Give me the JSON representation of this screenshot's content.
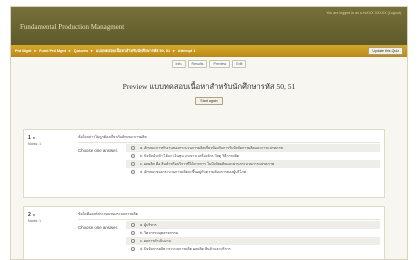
{
  "header": {
    "login_info": "You are logged in as นายXXX XXXXX (Logout)",
    "site_title": "Fundamental Production Managment"
  },
  "navbar": {
    "breadcrumbs": [
      "Prd Mgnt",
      "Fund Prd Mgnt",
      "Quizzes",
      "แบบทดสอบเนื้อหาสำหรับนักศึกษารหัส 50, 51",
      "Attempt 1"
    ],
    "separator": "►",
    "update_button": "Update this Quiz"
  },
  "tabs": [
    "Info",
    "Results",
    "Preview",
    "Edit"
  ],
  "page": {
    "title": "Preview แบบทดสอบเนื้อหาสำหรับนักศึกษารหัส 50, 51",
    "start_again": "Start again"
  },
  "questions": [
    {
      "number": "1",
      "suffix": "ข",
      "marks": "Marks: 1",
      "text": "ข้อใดกล่าวไม่ถูกต้องเกี่ยวกับลักษณะการผลิต",
      "choose_label": "Choose one answer.",
      "options": [
        "a. ลักษณะการทำงานของกระบวนการผลิตเกี่ยวข้องกับการรับปัจจัยการผลิตและการแปรสภาพ",
        "b. ปัจจัยนำเข้า ได้แก่ เงินทุน แรงงาน เครื่องจักร วัสดุ วิธีการผลิต",
        "c. ผลผลิต คือ สินค้าหรือบริการที่ได้จากการ ในปัจจัยผลิตและผ่านกระบวนการแปรสภาพ",
        "d. ลักษณะของกระบวนการผลิตจะขึ้นอยู่กับความต้องการของผู้บริโภค"
      ]
    },
    {
      "number": "2",
      "suffix": "ข",
      "marks": "Marks: 1",
      "text": "ข้อใดคือองค์ประกอบของระบบการผลิต",
      "choose_label": "Choose one answer.",
      "options": [
        "a. ผู้บริหาร",
        "b. วิศวกรรมอุตสาหกรรม",
        "c. ผลการดำเนินงาน",
        "d. ปัจจัยการผลิต กระบวนการผลิต ผลผลิต สินค้าและบริการ"
      ]
    }
  ]
}
